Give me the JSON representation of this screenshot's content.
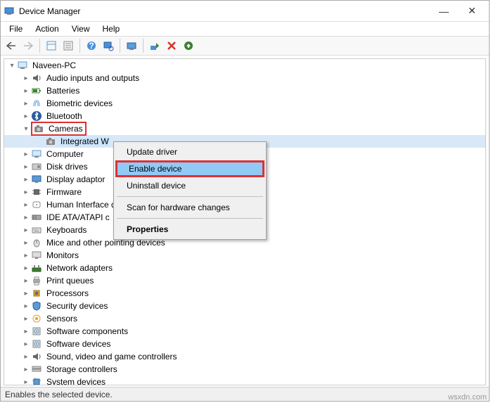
{
  "window": {
    "title": "Device Manager"
  },
  "menu": [
    "File",
    "Action",
    "View",
    "Help"
  ],
  "root": "Naveen-PC",
  "nodes": [
    {
      "label": "Audio inputs and outputs",
      "expand": "right",
      "icon": "audio"
    },
    {
      "label": "Batteries",
      "expand": "right",
      "icon": "battery"
    },
    {
      "label": "Biometric devices",
      "expand": "right",
      "icon": "bio"
    },
    {
      "label": "Bluetooth",
      "expand": "right",
      "icon": "bt"
    },
    {
      "label": "Cameras",
      "expand": "down",
      "icon": "camera",
      "boxed": true,
      "children": [
        {
          "label": "Integrated W",
          "icon": "camera",
          "selected": true
        }
      ]
    },
    {
      "label": "Computer",
      "expand": "right",
      "icon": "computer"
    },
    {
      "label": "Disk drives",
      "expand": "right",
      "icon": "disk"
    },
    {
      "label": "Display adaptor",
      "expand": "right",
      "icon": "display"
    },
    {
      "label": "Firmware",
      "expand": "right",
      "icon": "chip"
    },
    {
      "label": "Human Interface d",
      "expand": "right",
      "icon": "hid"
    },
    {
      "label": "IDE ATA/ATAPI c",
      "expand": "right",
      "icon": "ide"
    },
    {
      "label": "Keyboards",
      "expand": "right",
      "icon": "keyboard"
    },
    {
      "label": "Mice and other pointing devices",
      "expand": "right",
      "icon": "mouse"
    },
    {
      "label": "Monitors",
      "expand": "right",
      "icon": "monitor"
    },
    {
      "label": "Network adapters",
      "expand": "right",
      "icon": "net"
    },
    {
      "label": "Print queues",
      "expand": "right",
      "icon": "print"
    },
    {
      "label": "Processors",
      "expand": "right",
      "icon": "cpu"
    },
    {
      "label": "Security devices",
      "expand": "right",
      "icon": "sec"
    },
    {
      "label": "Sensors",
      "expand": "right",
      "icon": "sensor"
    },
    {
      "label": "Software components",
      "expand": "right",
      "icon": "sw"
    },
    {
      "label": "Software devices",
      "expand": "right",
      "icon": "sw"
    },
    {
      "label": "Sound, video and game controllers",
      "expand": "right",
      "icon": "audio"
    },
    {
      "label": "Storage controllers",
      "expand": "right",
      "icon": "storage"
    },
    {
      "label": "System devices",
      "expand": "right",
      "icon": "system"
    }
  ],
  "context": [
    {
      "label": "Update driver",
      "type": "item"
    },
    {
      "label": "Enable device",
      "type": "item",
      "highlighted": true,
      "boxed": true
    },
    {
      "label": "Uninstall device",
      "type": "item"
    },
    {
      "type": "sep"
    },
    {
      "label": "Scan for hardware changes",
      "type": "item"
    },
    {
      "type": "sep"
    },
    {
      "label": "Properties",
      "type": "item",
      "bold": true
    }
  ],
  "status": "Enables the selected device.",
  "watermark": "wsxdn.com"
}
